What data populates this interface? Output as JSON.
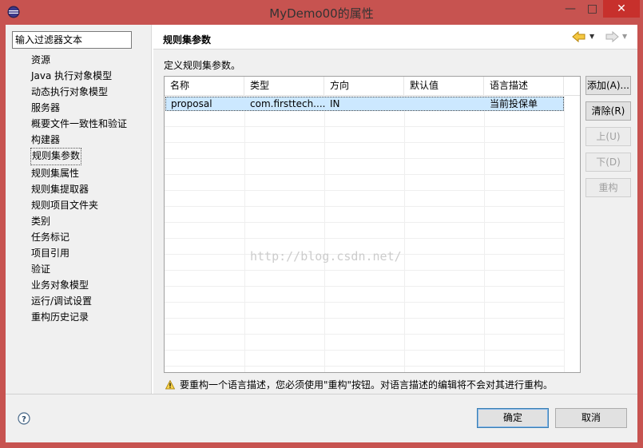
{
  "window": {
    "title": "MyDemo00的属性",
    "controls": {
      "minimize": "—",
      "maximize": "□",
      "close": "✕"
    }
  },
  "sidebar": {
    "filter_placeholder": "输入过滤器文本",
    "items": [
      {
        "label": "资源"
      },
      {
        "label": "Java 执行对象模型"
      },
      {
        "label": "动态执行对象模型"
      },
      {
        "label": "服务器"
      },
      {
        "label": "概要文件一致性和验证"
      },
      {
        "label": "构建器"
      },
      {
        "label": "规则集参数",
        "selected": true
      },
      {
        "label": "规则集属性"
      },
      {
        "label": "规则集提取器"
      },
      {
        "label": "规则项目文件夹"
      },
      {
        "label": "类别"
      },
      {
        "label": "任务标记"
      },
      {
        "label": "项目引用"
      },
      {
        "label": "验证"
      },
      {
        "label": "业务对象模型"
      },
      {
        "label": "运行/调试设置"
      },
      {
        "label": "重构历史记录"
      }
    ]
  },
  "page": {
    "title": "规则集参数",
    "description": "定义规则集参数。",
    "nav_icons": [
      "back-arrow-icon",
      "forward-arrow-icon"
    ]
  },
  "table": {
    "columns": [
      "名称",
      "类型",
      "方向",
      "默认值",
      "语言描述"
    ],
    "rows": [
      [
        "proposal",
        "com.firsttech....",
        "IN",
        "",
        "当前投保单"
      ]
    ]
  },
  "side_buttons": {
    "add": "添加(A)...",
    "remove": "清除(R)",
    "up": "上(U)",
    "down": "下(D)",
    "refactor": "重构"
  },
  "warning": "要重构一个语言描述，您必须使用\"重构\"按钮。对语言描述的编辑将不会对其进行重构。",
  "watermark": "http://blog.csdn.net/",
  "footer": {
    "ok": "确定",
    "cancel": "取消"
  },
  "colors": {
    "title_bar": "#c75350",
    "close_button": "#c7302c",
    "selection": "#cce8ff",
    "ok_border": "#3c7fb1"
  }
}
